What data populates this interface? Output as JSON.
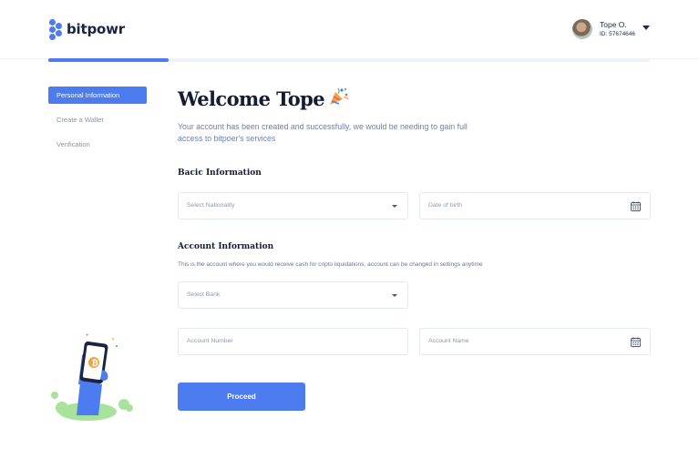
{
  "brand": {
    "name": "bitpowr",
    "accent": "#4c7cf0"
  },
  "user": {
    "name": "Tope O.",
    "id": "ID: 57674646"
  },
  "progress": {
    "percent": 20
  },
  "sidebar": {
    "items": [
      {
        "label": "Personal Information",
        "active": true
      },
      {
        "label": "Create a Wallet",
        "active": false
      },
      {
        "label": "Verification",
        "active": false
      }
    ]
  },
  "main": {
    "title": "Welcome Tope",
    "subtitle": "Your account has been created and successfully, we would be needing to gain full access to bitpoer's services",
    "basic": {
      "heading": "Bacic Information",
      "nationality_placeholder": "Select Nationality",
      "dob_placeholder": "Date of birth"
    },
    "account": {
      "heading": "Account Information",
      "description": "This is the account where you would receive cash for cripto liquidations, account can be changed in settings anytime",
      "bank_placeholder": "Select Bank",
      "number_placeholder": "Account Number",
      "name_placeholder": "Account Name"
    },
    "proceed_label": "Proceed"
  },
  "icons": [
    "logo-icon",
    "caret-down-icon",
    "party-popper-icon",
    "calendar-icon",
    "bitcoin-phone-illustration"
  ]
}
